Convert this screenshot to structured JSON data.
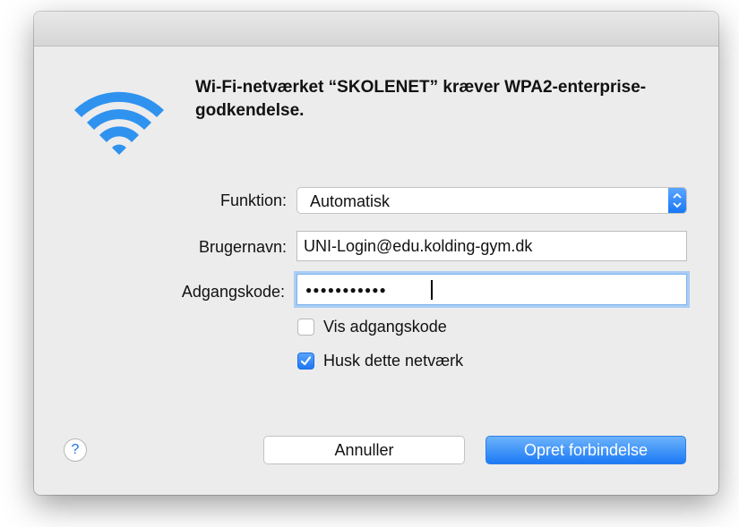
{
  "dialog": {
    "heading": "Wi-Fi-netværket “SKOLENET” kræver WPA2-enterprise-godkendelse.",
    "icon": "wifi-icon",
    "accent_color": "#1a78f5"
  },
  "form": {
    "mode_label": "Funktion:",
    "mode_value": "Automatisk",
    "username_label": "Brugernavn:",
    "username_value": "UNI-Login@edu.kolding-gym.dk",
    "password_label": "Adgangskode:",
    "password_masked": "●●●●●●●●●●●",
    "show_password_label": "Vis adgangskode",
    "show_password_checked": false,
    "remember_label": "Husk dette netværk",
    "remember_checked": true
  },
  "buttons": {
    "help_label": "?",
    "cancel_label": "Annuller",
    "connect_label": "Opret forbindelse"
  }
}
